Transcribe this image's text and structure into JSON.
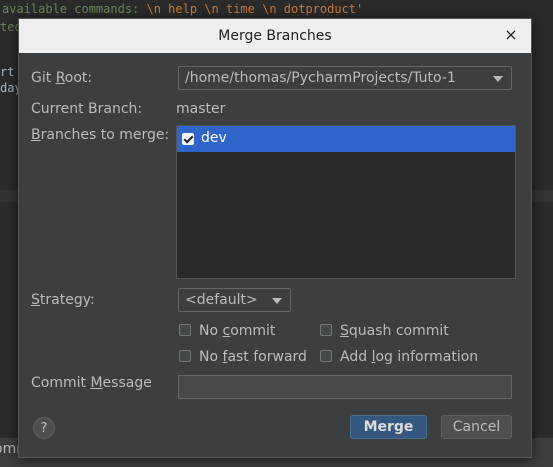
{
  "background": {
    "code_line_1_text": "available commands: ",
    "code_line_1_escapes": "\\n help \\n time \\n dotproduct'",
    "code_line_2": "ted",
    "code_line_3": "rt",
    "code_line_4": "day",
    "bottom_text": "ommands"
  },
  "dialog": {
    "title": "Merge Branches",
    "close_icon": "×",
    "git_root_label_pre": "Git ",
    "git_root_label_u": "R",
    "git_root_label_post": "oot:",
    "git_root_value": "/home/thomas/PycharmProjects/Tuto-1",
    "current_branch_label": "Current Branch:",
    "current_branch_value": "master",
    "branches_label_u": "B",
    "branches_label_post": "ranches to merge:",
    "branches": [
      {
        "name": "dev",
        "checked": true,
        "selected": true
      }
    ],
    "strategy_label_u": "S",
    "strategy_label_post": "trategy:",
    "strategy_value": "<default>",
    "options": {
      "no_commit_pre": "No ",
      "no_commit_u": "c",
      "no_commit_post": "ommit",
      "squash_commit_pre": "",
      "squash_commit_u": "S",
      "squash_commit_post": "quash commit",
      "no_fast_forward_pre": "No ",
      "no_fast_forward_u": "f",
      "no_fast_forward_post": "ast forward",
      "add_log_pre": "Add ",
      "add_log_u": "l",
      "add_log_post": "og information"
    },
    "commit_message_label_pre": "Commit ",
    "commit_message_label_u": "M",
    "commit_message_label_post": "essage",
    "commit_message_value": "",
    "help_label": "?",
    "merge_label": "Merge",
    "cancel_label": "Cancel"
  },
  "colors": {
    "accent": "#2f65ca",
    "primary_button": "#365880",
    "dialog_bg": "#3c3f41",
    "titlebar_bg": "#eeeeee"
  }
}
